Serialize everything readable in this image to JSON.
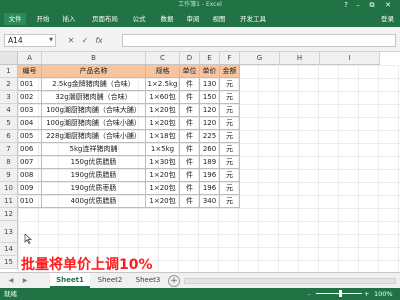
{
  "window": {
    "title": "工作簿1 - Excel",
    "min": "–",
    "max": "□",
    "close": "✕",
    "help": "?",
    "restore": "⧉"
  },
  "ribbon": {
    "tabs": [
      "文件",
      "开始",
      "插入",
      "页面布局",
      "公式",
      "数据",
      "审阅",
      "视图",
      "开发工具"
    ],
    "login": "登录"
  },
  "formula_bar": {
    "cell_ref": "A14",
    "cancel": "✕",
    "enter": "✓",
    "fx": "fx",
    "value": ""
  },
  "columns": [
    "A",
    "B",
    "C",
    "D",
    "E",
    "F",
    "G",
    "H",
    "I"
  ],
  "row_numbers": [
    "1",
    "2",
    "3",
    "4",
    "5",
    "6",
    "7",
    "8",
    "9",
    "10",
    "11",
    "12",
    "13",
    "14",
    "15"
  ],
  "table": {
    "headers": [
      "编号",
      "产品名称",
      "规格",
      "单位",
      "单价",
      "金额"
    ],
    "rows": [
      [
        "001",
        "2.5kg金牌猪肉脯（合味）",
        "1×2.5kg",
        "件",
        "130",
        "元"
      ],
      [
        "002",
        "32g潮厨猪肉脯（合味）",
        "1×60包",
        "件",
        "150",
        "元"
      ],
      [
        "003",
        "100g潮厨猪肉脯（合味大脯）",
        "1×20包",
        "件",
        "120",
        "元"
      ],
      [
        "004",
        "100g潮厨猪肉脯（合味小脯）",
        "1×20包",
        "件",
        "120",
        "元"
      ],
      [
        "005",
        "228g潮厨猪肉脯（合味小脯）",
        "1×18包",
        "件",
        "225",
        "元"
      ],
      [
        "006",
        "5kg连祥猪肉脯",
        "1×5kg",
        "件",
        "260",
        "元"
      ],
      [
        "007",
        "150g优质腊肠",
        "1×30包",
        "件",
        "189",
        "元"
      ],
      [
        "008",
        "190g优质腊肠",
        "1×20包",
        "件",
        "196",
        "元"
      ],
      [
        "009",
        "190g优质枣肠",
        "1×20包",
        "件",
        "196",
        "元"
      ],
      [
        "010",
        "400g优质腊肠",
        "1×20包",
        "件",
        "340",
        "元"
      ]
    ]
  },
  "headline": "批量将单价上调10%",
  "sheets": {
    "tabs": [
      "Sheet1",
      "Sheet2",
      "Sheet3"
    ],
    "active": "Sheet1",
    "add": "+",
    "prev": "◀",
    "next": "▶"
  },
  "status": {
    "text": "就绪",
    "zoom": "100%",
    "zoom_minus": "-",
    "zoom_plus": "+"
  },
  "colors": {
    "excel_green": "#217346",
    "header_fill": "#f7c49d",
    "headline_red": "#ff1c1c"
  }
}
